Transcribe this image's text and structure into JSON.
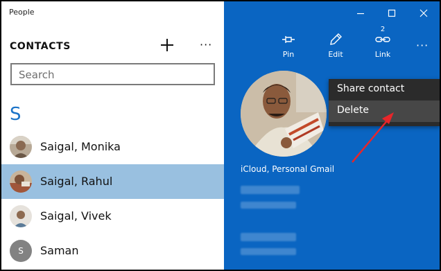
{
  "app": {
    "title": "People"
  },
  "contacts": {
    "heading": "CONTACTS",
    "more_label": "···",
    "search": {
      "placeholder": "Search"
    },
    "group_letter": "S",
    "items": [
      {
        "name": "Saigal, Monika",
        "selected": false
      },
      {
        "name": "Saigal, Rahul",
        "selected": true
      },
      {
        "name": "Saigal, Vivek",
        "selected": false
      },
      {
        "name": "Saman",
        "selected": false,
        "initial": "S"
      }
    ]
  },
  "toolbar": {
    "pin_label": "Pin",
    "edit_label": "Edit",
    "link_label": "Link",
    "link_count": "2",
    "more_label": "···"
  },
  "detail": {
    "account_label": "iCloud, Personal Gmail"
  },
  "context_menu": {
    "items": [
      {
        "label": "Share contact"
      },
      {
        "label": "Delete"
      }
    ]
  },
  "colors": {
    "accent": "#0a65c2",
    "selection": "#99c0e0",
    "group_letter": "#1a73c8",
    "menu_bg": "#2b2b2b",
    "arrow": "#e8262a"
  }
}
